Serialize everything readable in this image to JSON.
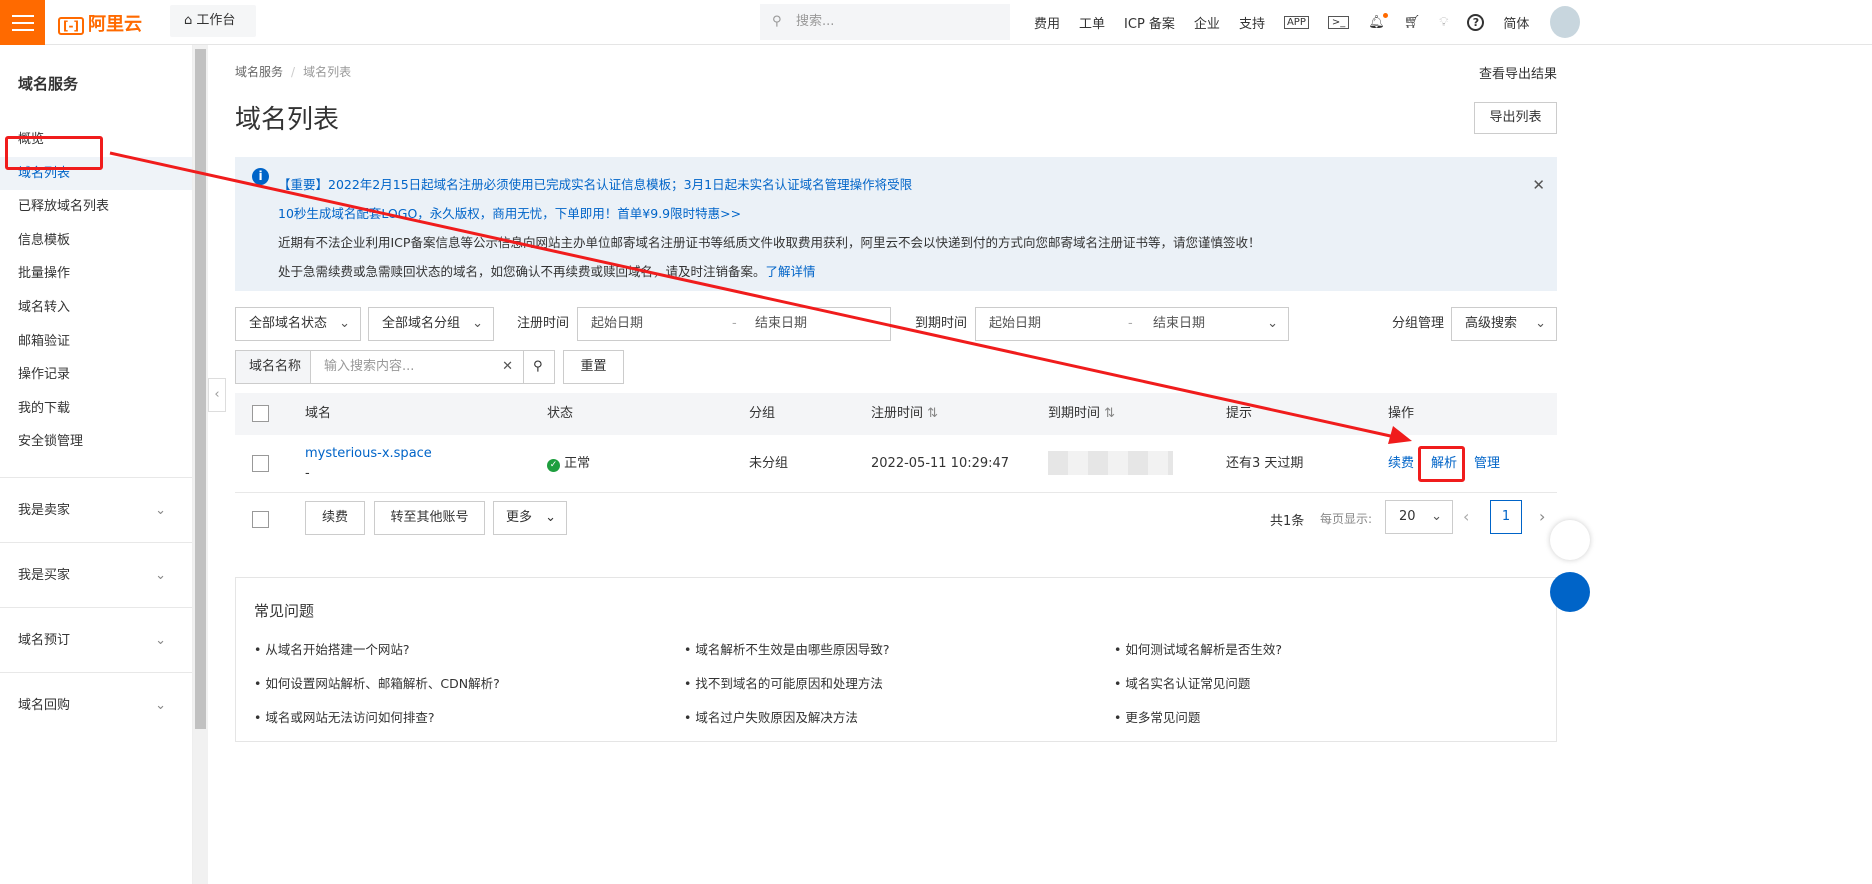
{
  "topbar": {
    "logo": "阿里云",
    "workbench": "工作台",
    "search_placeholder": "搜索...",
    "nav": [
      "费用",
      "工单",
      "ICP 备案",
      "企业",
      "支持"
    ],
    "lang": "简体"
  },
  "sidebar": {
    "title": "域名服务",
    "items": [
      "概览",
      "域名列表",
      "已释放域名列表",
      "信息模板",
      "批量操作",
      "域名转入",
      "邮箱验证",
      "操作记录",
      "我的下载",
      "安全锁管理"
    ],
    "groups": [
      "我是卖家",
      "我是买家",
      "域名预订",
      "域名回购"
    ]
  },
  "breadcrumb": [
    "域名服务",
    "域名列表"
  ],
  "export_results": "查看导出结果",
  "page_title": "域名列表",
  "export_button": "导出列表",
  "notice": {
    "line1": "【重要】2022年2月15日起域名注册必须使用已完成实名认证信息模板；3月1日起未实名认证域名管理操作将受限",
    "line2": "10秒生成域名配套LOGO，永久版权，商用无忧，下单即用！首单¥9.9限时特惠>>",
    "line3": "近期有不法企业利用ICP备案信息等公示信息向网站主办单位邮寄域名注册证书等纸质文件收取费用获利，阿里云不会以快递到付的方式向您邮寄域名注册证书等，请您谨慎签收！",
    "line4": "处于急需续费或急需赎回状态的域名，如您确认不再续费或赎回域名，请及时注销备案。",
    "line4_link": "了解详情"
  },
  "filters": {
    "status": "全部域名状态",
    "group": "全部域名分组",
    "reg_label": "注册时间",
    "reg_start": "起始日期",
    "reg_end": "结束日期",
    "exp_label": "到期时间",
    "exp_start": "起始日期",
    "exp_end": "结束日期",
    "group_manage": "分组管理",
    "advanced": "高级搜索",
    "name_label": "域名名称",
    "name_placeholder": "输入搜索内容...",
    "reset": "重置"
  },
  "table": {
    "headers": [
      "域名",
      "状态",
      "分组",
      "注册时间",
      "到期时间",
      "提示",
      "操作"
    ],
    "rows": [
      {
        "domain": "mysterious-x.space",
        "sub": "-",
        "status": "正常",
        "group": "未分组",
        "reg_time": "2022-05-11 10:29:47",
        "hint": "还有3  天过期",
        "actions": [
          "续费",
          "解析",
          "管理"
        ]
      }
    ]
  },
  "bulk": {
    "renew": "续费",
    "transfer": "转至其他账号",
    "more": "更多"
  },
  "pagination": {
    "total": "共1条",
    "per_page_label": "每页显示:",
    "per_page": "20",
    "page": "1"
  },
  "faq": {
    "title": "常见问题",
    "items": [
      "从域名开始搭建一个网站?",
      "域名解析不生效是由哪些原因导致?",
      "如何测试域名解析是否生效?",
      "如何设置网站解析、邮箱解析、CDN解析?",
      "找不到域名的可能原因和处理方法",
      "域名实名认证常见问题",
      "域名或网站无法访问如何排查?",
      "域名过户失败原因及解决方法",
      "更多常见问题"
    ]
  },
  "colors": {
    "brand": "#ff6a00",
    "link": "#0064c8",
    "annotation": "#f01c1c",
    "success": "#1e9e3e"
  }
}
